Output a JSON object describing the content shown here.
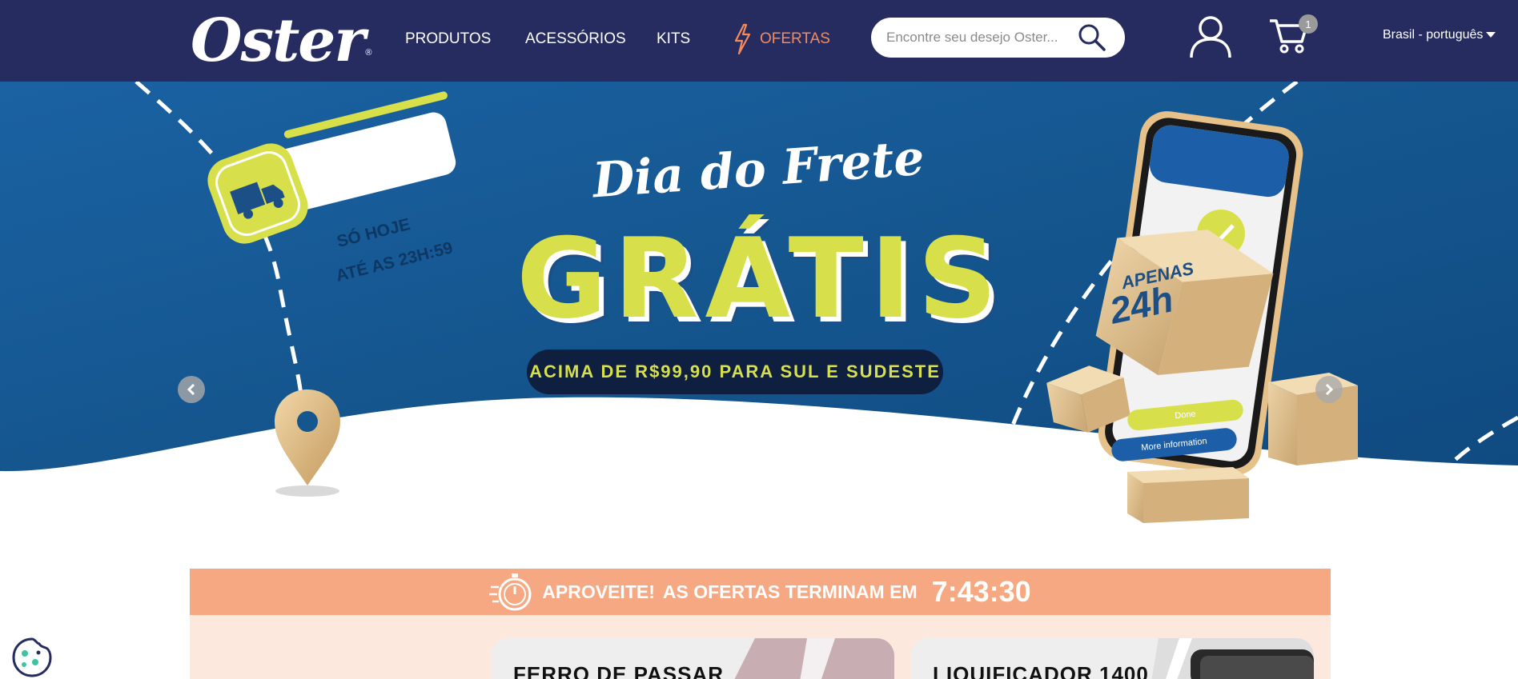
{
  "brand": {
    "logo_text": "Oster",
    "registered": "®"
  },
  "nav": {
    "produtos": "PRODUTOS",
    "acessorios": "ACESSÓRIOS",
    "kits": "KITS",
    "ofertas": "OFERTAS"
  },
  "search": {
    "placeholder": "Encontre seu desejo Oster..."
  },
  "cart": {
    "count": "1"
  },
  "language": {
    "label": "Brasil - português"
  },
  "banner": {
    "badge_line1": "SÓ HOJE",
    "badge_line2": "ATÉ AS 23H:59",
    "title_script": "Dia do Frete",
    "title_big": "GRÁTIS",
    "subtitle": "ACIMA DE R$99,90 PARA SUL E SUDESTE",
    "box_line1": "APENAS",
    "box_line2": "24h",
    "phone_button_1": "Done",
    "phone_button_2": "More information"
  },
  "offers": {
    "label_1": "APROVEITE!",
    "label_2": "AS OFERTAS TERMINAM EM",
    "timer": "7:43:30"
  },
  "products": [
    {
      "title": "FERRO DE PASSAR"
    },
    {
      "title": "LIQUIFICADOR 1400"
    }
  ],
  "colors": {
    "header_bg": "#262c5f",
    "accent_orange": "#f58b5a",
    "banner_blue": "#15568f",
    "lime": "#d7e04a",
    "offers_bar": "#f6a882"
  }
}
